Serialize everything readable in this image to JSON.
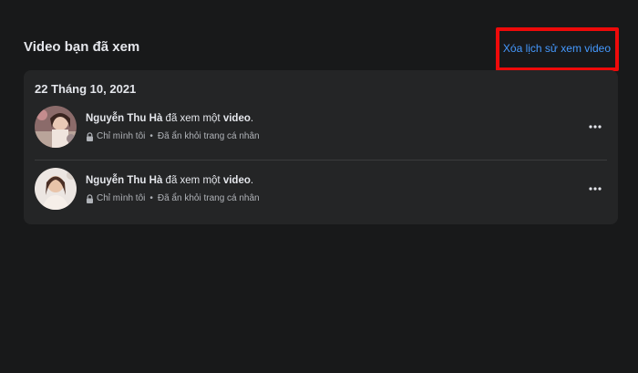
{
  "page": {
    "title": "Video bạn đã xem",
    "clear_history_label": "Xóa lịch sử xem video"
  },
  "card": {
    "date": "22 Tháng 10, 2021",
    "entries": [
      {
        "user_name": "Nguyễn Thu Hà",
        "action": "đã xem một",
        "object": "video",
        "suffix": ".",
        "privacy": "Chỉ mình tôi",
        "status": "Đã ẩn khỏi trang cá nhân"
      },
      {
        "user_name": "Nguyễn Thu Hà",
        "action": "đã xem một",
        "object": "video",
        "suffix": ".",
        "privacy": "Chỉ mình tôi",
        "status": "Đã ẩn khỏi trang cá nhân"
      }
    ]
  },
  "separator": "•",
  "icons": {
    "lock": "lock-icon",
    "more": "more-horizontal-icon"
  },
  "colors": {
    "background": "#18191a",
    "card": "#242526",
    "link": "#4599ff",
    "annotation_red": "#ee0a0a"
  }
}
